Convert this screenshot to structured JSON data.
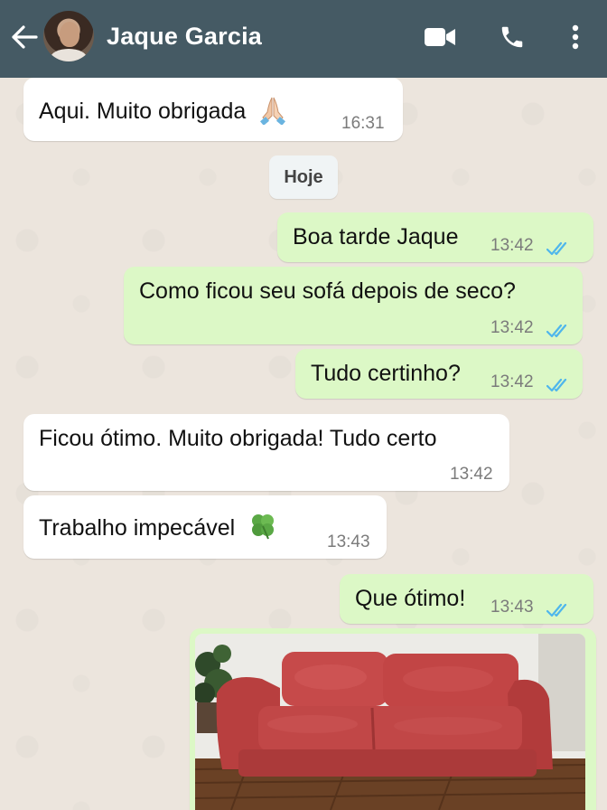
{
  "header": {
    "contact_name": "Jaque Garcia",
    "icons": [
      "back-arrow-icon",
      "video-call-icon",
      "phone-call-icon",
      "more-options-icon"
    ],
    "bar_color": "#455a64"
  },
  "date_separator": "Hoje",
  "messages": [
    {
      "direction": "incoming",
      "text": "Aqui. Muito obrigada",
      "emoji": "praying-hands-icon",
      "time": "16:31"
    },
    {
      "direction": "outgoing",
      "text": "Boa tarde Jaque",
      "time": "13:42",
      "status": "read"
    },
    {
      "direction": "outgoing",
      "text": "Como ficou seu sofá depois de seco?",
      "time": "13:42",
      "status": "read"
    },
    {
      "direction": "outgoing",
      "text": "Tudo certinho?",
      "time": "13:42",
      "status": "read"
    },
    {
      "direction": "incoming",
      "text": "Ficou ótimo. Muito obrigada! Tudo certo",
      "time": "13:42"
    },
    {
      "direction": "incoming",
      "text": "Trabalho impecável",
      "emoji": "four-leaf-clover-icon",
      "time": "13:43"
    },
    {
      "direction": "outgoing",
      "text": "Que ótimo!",
      "time": "13:43",
      "status": "read"
    },
    {
      "direction": "outgoing",
      "type": "image",
      "image_subject": "red-sofa-photo"
    }
  ],
  "colors": {
    "incoming_bubble": "#ffffff",
    "outgoing_bubble": "#dcf8c6",
    "read_ticks": "#4fb6ec",
    "chat_background": "#ece5dd"
  }
}
